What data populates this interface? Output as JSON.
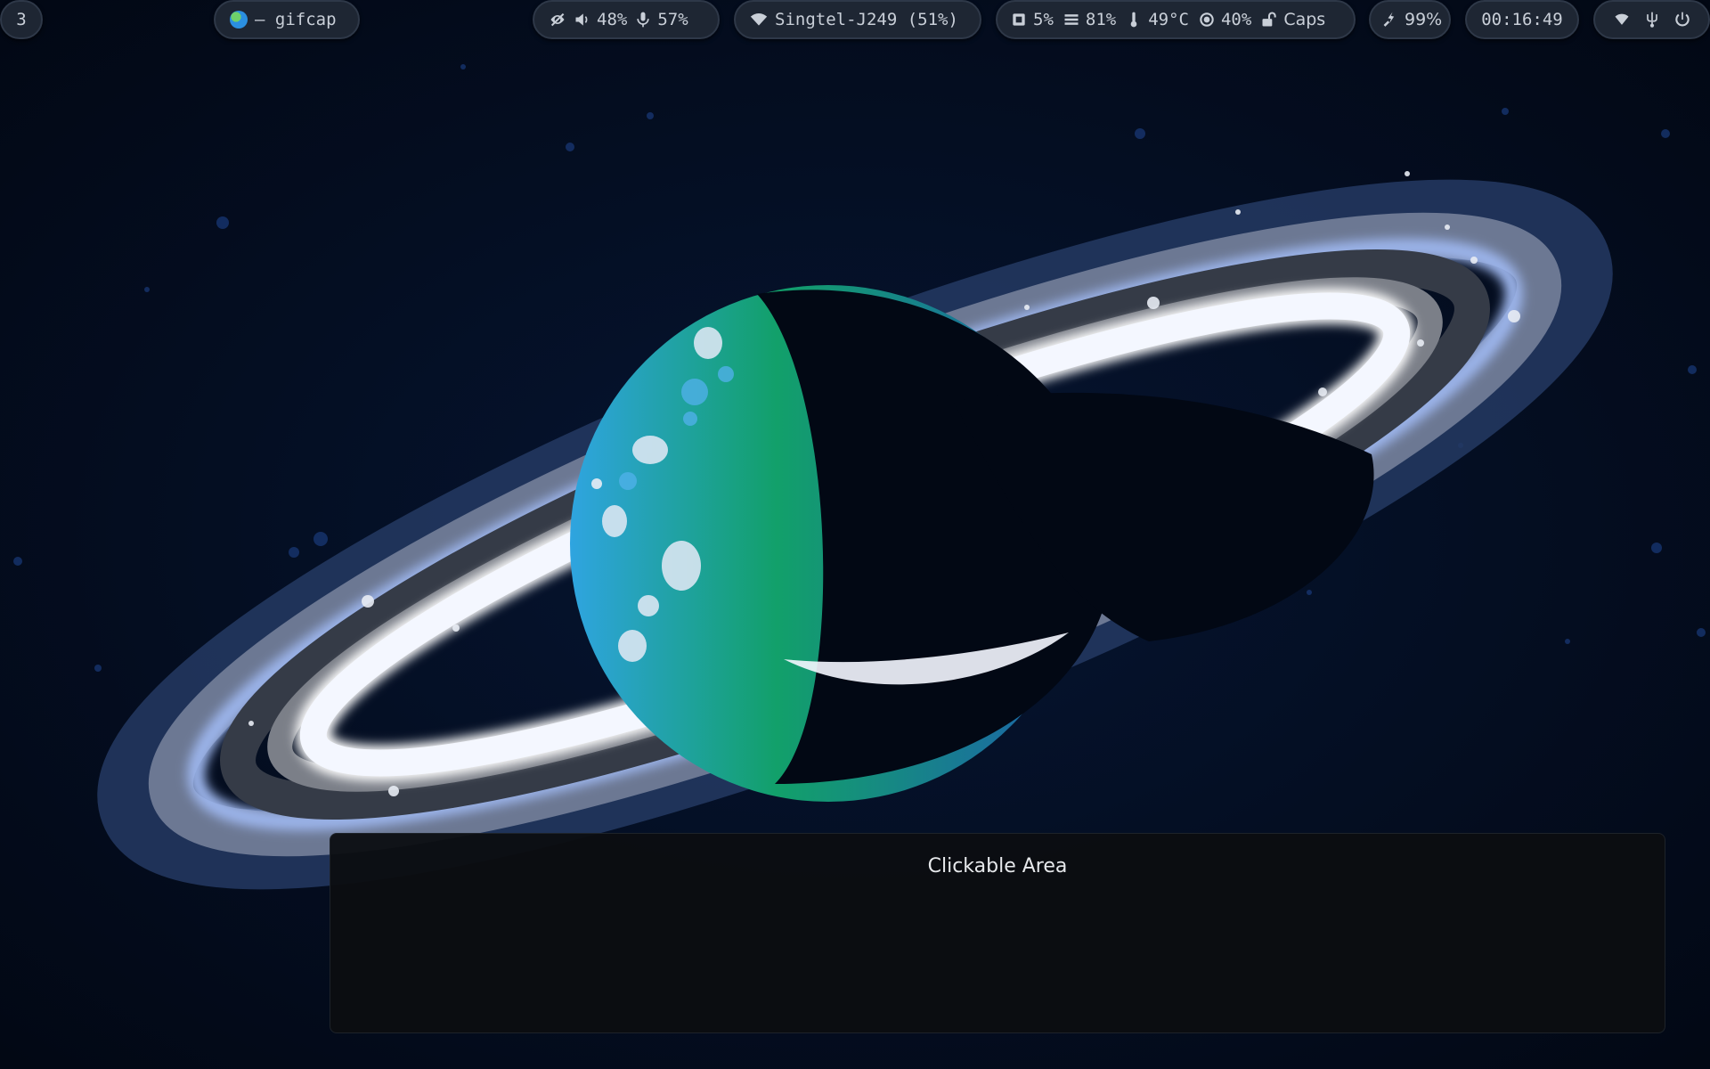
{
  "topbar": {
    "workspace": "3",
    "window_title": "– gifcap",
    "audio": {
      "volume": "48%",
      "mic": "57%"
    },
    "network": {
      "wifi": "Singtel-J249 (51%)"
    },
    "system": {
      "cpu": "5%",
      "memory": "81%",
      "temperature": "49°C",
      "brightness": "40%",
      "caps": "Caps"
    },
    "battery": "99%",
    "clock": "00:16:49"
  },
  "icons": {
    "app": "globe-icon",
    "privacy": "eye-slash-icon",
    "volume": "speaker-icon",
    "mic": "microphone-icon",
    "wifi": "wifi-icon",
    "cpu": "cpu-icon",
    "memory": "memory-icon",
    "temperature": "thermometer-icon",
    "brightness": "brightness-icon",
    "caps": "unlock-icon",
    "battery": "plug-icon",
    "tray_wifi": "wifi-icon",
    "tray_usb": "usb-icon",
    "power": "power-icon"
  },
  "overlay": {
    "label": "Clickable Area"
  },
  "colors": {
    "background": "#030a18",
    "bar_pill": "#1e2633",
    "bar_text": "#c9cfd8",
    "ring_light": "#9bb4ea"
  }
}
